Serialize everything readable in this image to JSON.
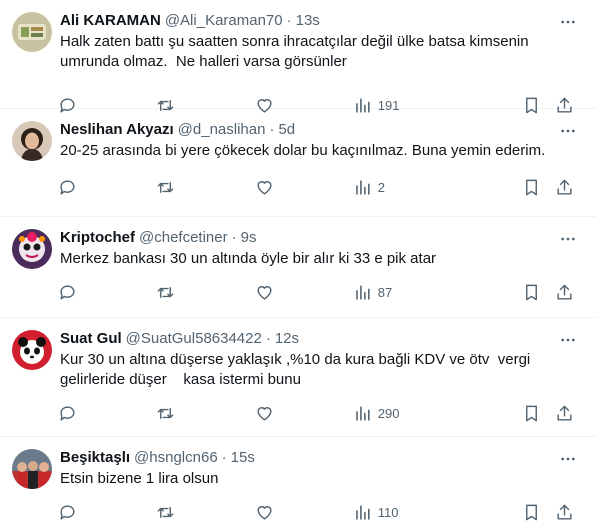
{
  "tweets": [
    {
      "name": "Ali KARAMAN",
      "handle": "@Ali_Karaman70",
      "time": "13s",
      "text": "Halk zaten battı şu saatten sonra ihracatçılar değil ülke batsa kimsenin umrunda olmaz.  Ne halleri varsa görsünler",
      "views": "191",
      "avatar_color": "#c9c2a2"
    },
    {
      "name": "Neslihan Akyazı",
      "handle": "@d_naslihan",
      "time": "5d",
      "text": "20-25 arasında bi yere çökecek dolar bu kaçınılmaz. Buna yemin ederim.",
      "views": "2",
      "avatar_color": "#3a2a24"
    },
    {
      "name": "Kriptochef",
      "handle": "@chefcetiner",
      "time": "9s",
      "text": "Merkez bankası 30 un altında öyle bir alır ki 33 e pik atar",
      "views": "87",
      "avatar_color": "#7a3e6a"
    },
    {
      "name": "Suat Gul",
      "handle": "@SuatGul58634422",
      "time": "12s",
      "text": "Kur 30 un altına düşerse yaklaşık ,%10 da kura bağli KDV ve ötv  vergi gelirleride düşer    kasa istermi bunu",
      "views": "290",
      "avatar_color": "#d11f2e"
    },
    {
      "name": "Beşiktaşlı",
      "handle": "@hsnglcn66",
      "time": "15s",
      "text": "Etsin bizene 1 lira olsun",
      "views": "110",
      "avatar_color": "#b73535"
    }
  ],
  "separator": "·",
  "icons": {
    "more": "more-dots-icon",
    "reply": "reply-icon",
    "retweet": "retweet-icon",
    "like": "like-icon",
    "views": "views-icon",
    "bookmark": "bookmark-icon",
    "share": "share-icon"
  },
  "colors": {
    "text": "#0f1419",
    "muted": "#536471",
    "divider": "#eff3f4"
  }
}
